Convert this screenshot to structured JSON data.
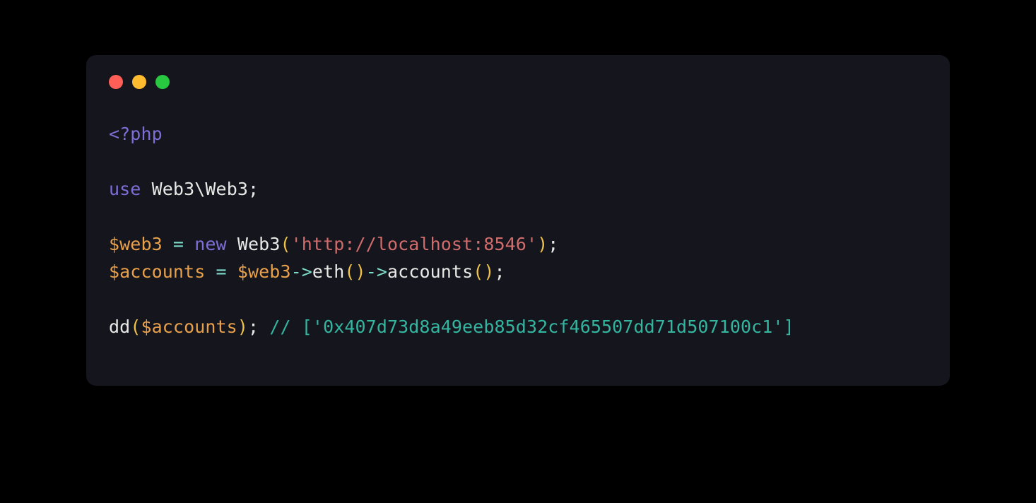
{
  "colors": {
    "bg": "#000000",
    "panel": "#15161d",
    "dotRed": "#ff5f57",
    "dotYellow": "#febc2e",
    "dotGreen": "#28c840",
    "tag": "#7c6fd8",
    "keyword": "#7c6fd8",
    "plain": "#e8e8e6",
    "var": "#e8a04b",
    "op": "#7fdbca",
    "string": "#d16c6c",
    "paren": "#f1c248",
    "comment": "#34b5a0"
  },
  "code": {
    "lines": [
      [
        {
          "t": "<?php",
          "c": "tok-tag"
        }
      ],
      [],
      [
        {
          "t": "use",
          "c": "tok-keyword"
        },
        {
          "t": " Web3",
          "c": "tok-plain"
        },
        {
          "t": "\\",
          "c": "tok-punct"
        },
        {
          "t": "Web3",
          "c": "tok-plain"
        },
        {
          "t": ";",
          "c": "tok-punct"
        }
      ],
      [],
      [
        {
          "t": "$web3",
          "c": "tok-var"
        },
        {
          "t": " ",
          "c": "tok-plain"
        },
        {
          "t": "=",
          "c": "tok-op"
        },
        {
          "t": " ",
          "c": "tok-plain"
        },
        {
          "t": "new",
          "c": "tok-keyword"
        },
        {
          "t": " ",
          "c": "tok-plain"
        },
        {
          "t": "Web3",
          "c": "tok-class"
        },
        {
          "t": "(",
          "c": "tok-paren"
        },
        {
          "t": "'http://localhost:8546'",
          "c": "tok-string"
        },
        {
          "t": ")",
          "c": "tok-paren"
        },
        {
          "t": ";",
          "c": "tok-punct"
        }
      ],
      [
        {
          "t": "$accounts",
          "c": "tok-var"
        },
        {
          "t": " ",
          "c": "tok-plain"
        },
        {
          "t": "=",
          "c": "tok-op"
        },
        {
          "t": " ",
          "c": "tok-plain"
        },
        {
          "t": "$web3",
          "c": "tok-var"
        },
        {
          "t": "->",
          "c": "tok-op"
        },
        {
          "t": "eth",
          "c": "tok-func"
        },
        {
          "t": "()",
          "c": "tok-paren"
        },
        {
          "t": "->",
          "c": "tok-op"
        },
        {
          "t": "accounts",
          "c": "tok-func"
        },
        {
          "t": "()",
          "c": "tok-paren"
        },
        {
          "t": ";",
          "c": "tok-punct"
        }
      ],
      [],
      [
        {
          "t": "dd",
          "c": "tok-func"
        },
        {
          "t": "(",
          "c": "tok-paren"
        },
        {
          "t": "$accounts",
          "c": "tok-var"
        },
        {
          "t": ")",
          "c": "tok-paren"
        },
        {
          "t": ";",
          "c": "tok-punct"
        },
        {
          "t": " ",
          "c": "tok-plain"
        },
        {
          "t": "// ['0x407d73d8a49eeb85d32cf465507dd71d507100c1']",
          "c": "tok-comment"
        }
      ]
    ]
  }
}
